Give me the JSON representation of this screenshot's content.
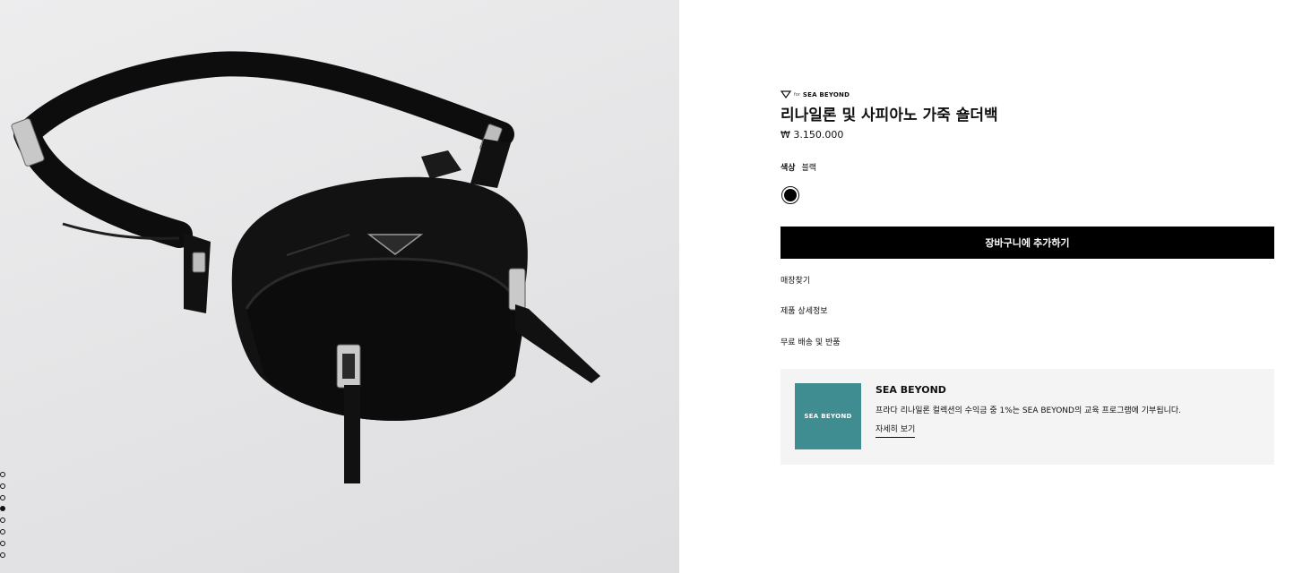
{
  "gallery": {
    "image_alt": "black nylon and leather shoulder bag",
    "dots_total": 8,
    "active_dot": 4
  },
  "product": {
    "brand_for": "for",
    "brand_name": "SEA BEYOND",
    "title": "리나일론 및 사피아노 가죽 숄더백",
    "price": "₩ 3.150.000",
    "color_label": "색상",
    "color_value": "블랙",
    "swatch_color": "#000000",
    "add_to_cart": "장바구니에 추가하기",
    "links": [
      "매장찾기",
      "제품 상세정보",
      "무료 배송 및 반품"
    ]
  },
  "promo": {
    "image_text": "SEA BEYOND",
    "image_color": "#3f8c91",
    "title": "SEA BEYOND",
    "text": "프라다 리나일론 컬렉션의 수익금 중 1%는 SEA BEYOND의 교육 프로그램에 기부됩니다.",
    "link": "자세히 보기"
  }
}
